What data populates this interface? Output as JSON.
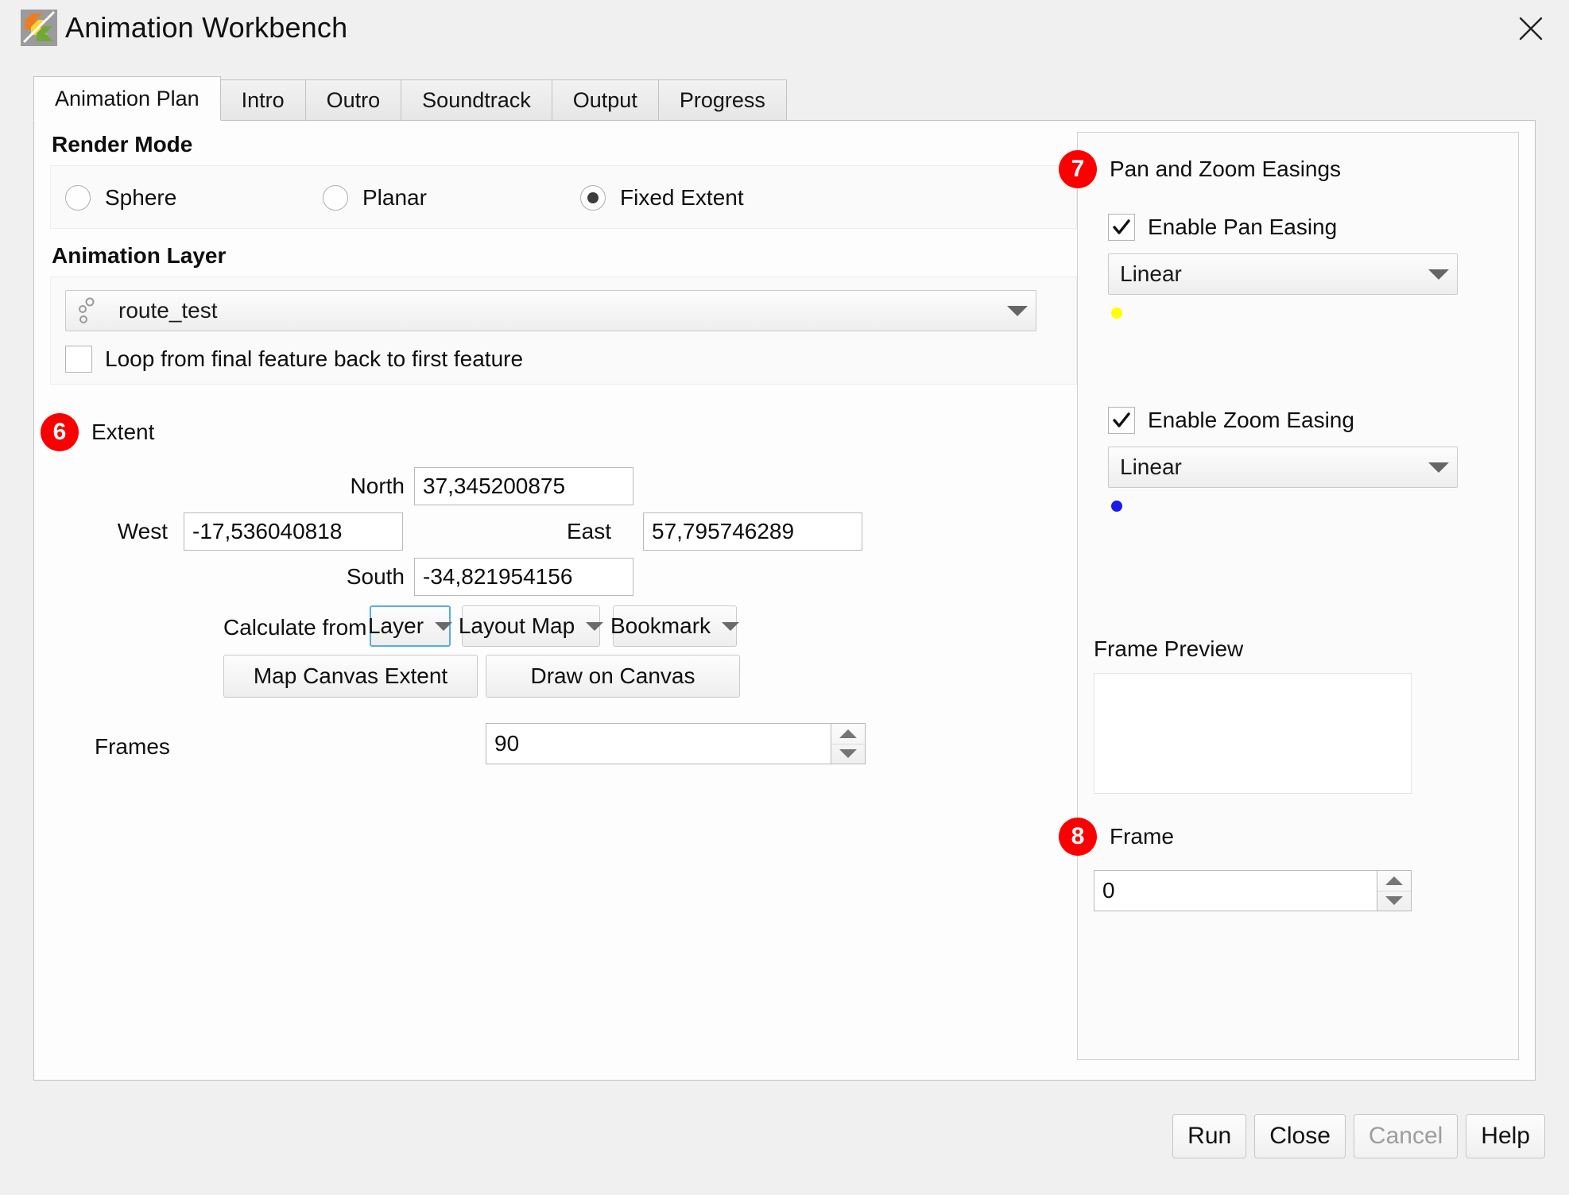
{
  "window": {
    "title": "Animation Workbench",
    "icon": "qgis-animation-workbench-logo-icon",
    "close_label": "close-icon"
  },
  "tabs": [
    {
      "label": "Animation Plan",
      "active": true
    },
    {
      "label": "Intro",
      "active": false
    },
    {
      "label": "Outro",
      "active": false
    },
    {
      "label": "Soundtrack",
      "active": false
    },
    {
      "label": "Output",
      "active": false
    },
    {
      "label": "Progress",
      "active": false
    }
  ],
  "render_mode": {
    "title": "Render Mode",
    "options": [
      {
        "label": "Sphere",
        "selected": false
      },
      {
        "label": "Planar",
        "selected": false
      },
      {
        "label": "Fixed Extent",
        "selected": true
      }
    ]
  },
  "animation_layer": {
    "title": "Animation Layer",
    "selected_layer": "route_test",
    "layer_icon": "point-layer-icon",
    "loop_checkbox": {
      "label": "Loop from final feature back to first feature",
      "checked": false
    }
  },
  "extent": {
    "badge": "6",
    "title": "Extent",
    "north_label": "North",
    "north_value": "37,345200875",
    "west_label": "West",
    "west_value": "-17,536040818",
    "east_label": "East",
    "east_value": "57,795746289",
    "south_label": "South",
    "south_value": "-34,821954156",
    "calculate_from_label": "Calculate from",
    "calc_buttons": [
      {
        "label": "Layer",
        "focused": true
      },
      {
        "label": "Layout Map",
        "focused": false
      },
      {
        "label": "Bookmark",
        "focused": false
      }
    ],
    "action_buttons": [
      {
        "label": "Map Canvas Extent"
      },
      {
        "label": "Draw on Canvas"
      }
    ]
  },
  "frames": {
    "label": "Frames",
    "value": "90"
  },
  "easings": {
    "badge": "7",
    "title": "Pan and Zoom Easings",
    "pan": {
      "checkbox_label": "Enable Pan Easing",
      "checked": true,
      "easing_value": "Linear",
      "marker_color": "#ffff00"
    },
    "zoom": {
      "checkbox_label": "Enable Zoom Easing",
      "checked": true,
      "easing_value": "Linear",
      "marker_color": "#1a1aee"
    }
  },
  "frame_preview": {
    "title": "Frame Preview"
  },
  "frame": {
    "badge": "8",
    "label": "Frame",
    "value": "0"
  },
  "footer_buttons": [
    {
      "label": "Run",
      "disabled": false
    },
    {
      "label": "Close",
      "disabled": false
    },
    {
      "label": "Cancel",
      "disabled": true
    },
    {
      "label": "Help",
      "disabled": false
    }
  ],
  "colors": {
    "badge_red": "#fa0000",
    "focus_blue": "#5aabe8",
    "pan_marker": "#ffff00",
    "zoom_marker": "#1a1aee"
  }
}
